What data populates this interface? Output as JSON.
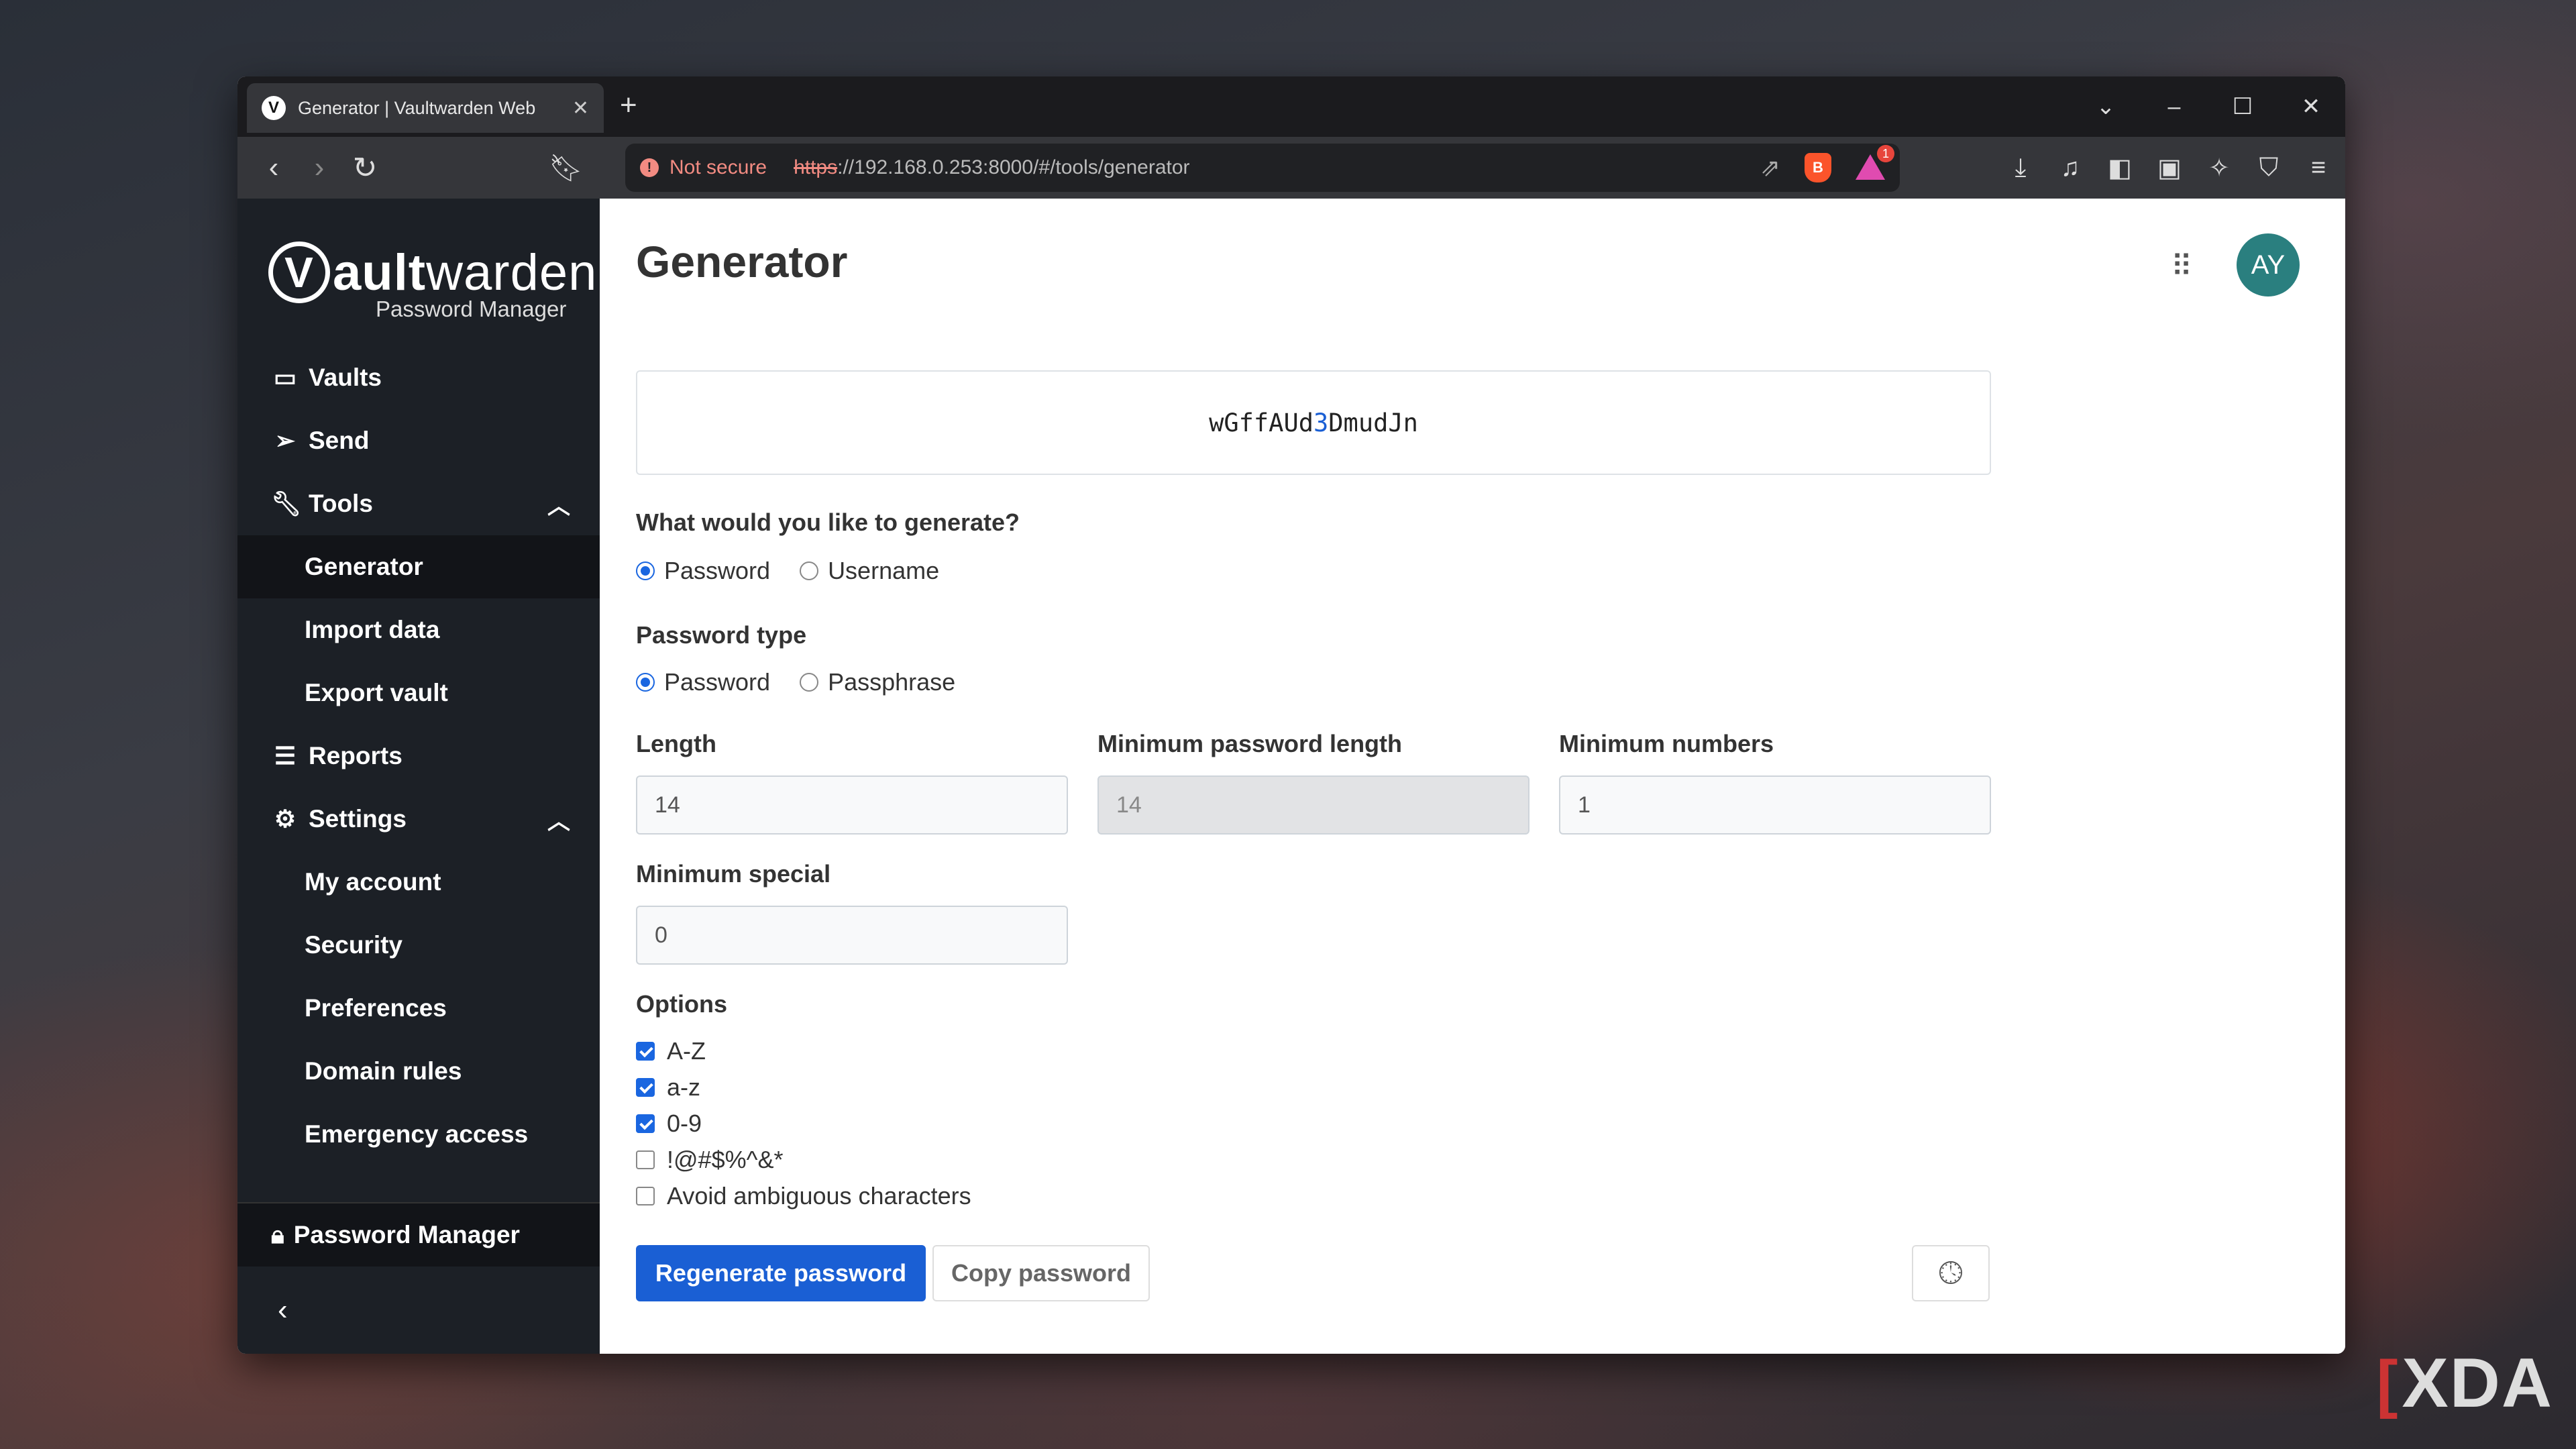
{
  "browser": {
    "tab_title": "Generator | Vaultwarden Web",
    "favicon_letter": "V",
    "security_label": "Not secure",
    "url_protocol": "https",
    "url_rest": "://192.168.0.253:8000/#/tools/generator",
    "rewards_badge": "1"
  },
  "sidebar": {
    "brand_initial": "V",
    "brand_name_bold": "ault",
    "brand_name_rest": "warden",
    "brand_subtitle": "Password Manager",
    "vaults": "Vaults",
    "send": "Send",
    "tools": "Tools",
    "tools_items": [
      "Generator",
      "Import data",
      "Export vault"
    ],
    "reports": "Reports",
    "settings": "Settings",
    "settings_items": [
      "My account",
      "Security",
      "Preferences",
      "Domain rules",
      "Emergency access"
    ],
    "footer_label": "Password Manager"
  },
  "main": {
    "title": "Generator",
    "avatar": "AY",
    "password_prefix": "wGffAUd",
    "password_digit": "3",
    "password_suffix": "DmudJn",
    "generate_question": "What would you like to generate?",
    "generate_options": [
      "Password",
      "Username"
    ],
    "password_type_label": "Password type",
    "password_type_options": [
      "Password",
      "Passphrase"
    ],
    "length_label": "Length",
    "length_value": "14",
    "min_length_label": "Minimum password length",
    "min_length_value": "14",
    "min_numbers_label": "Minimum numbers",
    "min_numbers_value": "1",
    "min_special_label": "Minimum special",
    "min_special_value": "0",
    "options_label": "Options",
    "options": [
      {
        "label": "A-Z",
        "checked": true
      },
      {
        "label": "a-z",
        "checked": true
      },
      {
        "label": "0-9",
        "checked": true
      },
      {
        "label": "!@#$%^&*",
        "checked": false
      },
      {
        "label": "Avoid ambiguous characters",
        "checked": false
      }
    ],
    "regenerate_label": "Regenerate password",
    "copy_label": "Copy password"
  },
  "watermark": {
    "text": "XDA"
  },
  "colors": {
    "accent": "#1a5fd4",
    "sidebar": "#1c2026",
    "avatar": "#2a7f7f"
  }
}
